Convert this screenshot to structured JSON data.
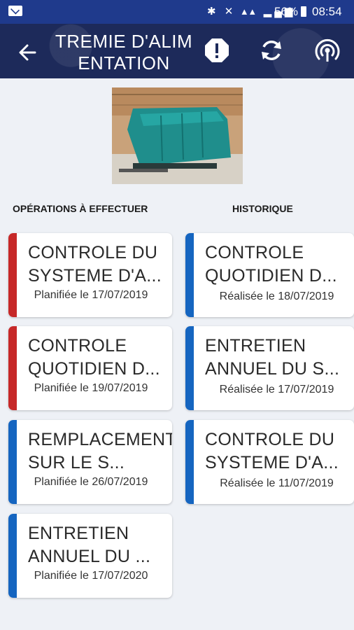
{
  "status_bar": {
    "battery": "56%",
    "time": "08:54"
  },
  "header": {
    "title": "TREMIE D'ALIM ENTATION"
  },
  "sections": {
    "operations_title": "OPÉRATIONS À EFFECTUER",
    "history_title": "HISTORIQUE"
  },
  "operations": [
    {
      "name": "CONTROLE DU SYSTEME D'A...",
      "date": "Planifiée le 17/07/2019",
      "color": "#c62828"
    },
    {
      "name": "CONTROLE QUOTIDIEN D...",
      "date": "Planifiée le 19/07/2019",
      "color": "#c62828"
    },
    {
      "name": "REMPLACEMENT SUR LE S...",
      "date": "Planifiée le 26/07/2019",
      "color": "#1565c0"
    },
    {
      "name": "ENTRETIEN ANNUEL DU ...",
      "date": "Planifiée le 17/07/2020",
      "color": "#1565c0"
    }
  ],
  "history": [
    {
      "name": "CONTROLE QUOTIDIEN D...",
      "date": "Réalisée le 18/07/2019",
      "color": "#1565c0"
    },
    {
      "name": "ENTRETIEN ANNUEL DU S...",
      "date": "Réalisée le 17/07/2019",
      "color": "#1565c0"
    },
    {
      "name": "CONTROLE DU SYSTEME D'A...",
      "date": "Réalisée le 11/07/2019",
      "color": "#1565c0"
    }
  ],
  "colors": {
    "status_bar": "#1f3a8c",
    "app_bar": "#1d2a5a",
    "urgent": "#c62828",
    "normal": "#1565c0"
  }
}
